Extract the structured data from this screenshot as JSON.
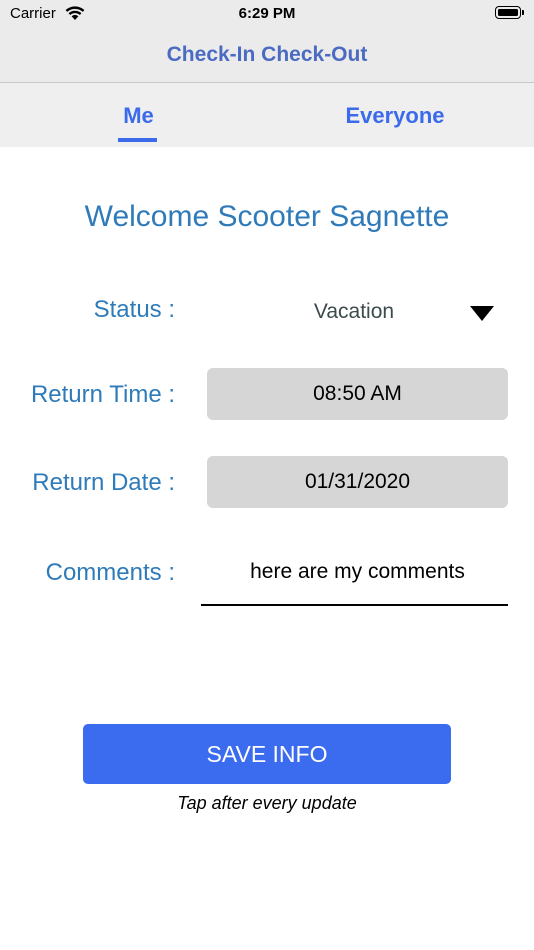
{
  "status_bar": {
    "carrier": "Carrier",
    "time": "6:29 PM"
  },
  "nav": {
    "title": "Check-In Check-Out"
  },
  "tabs": [
    {
      "label": "Me",
      "selected": true
    },
    {
      "label": "Everyone",
      "selected": false
    }
  ],
  "welcome": "Welcome Scooter Sagnette",
  "form": {
    "status_label": "Status :",
    "status_value": "Vacation",
    "return_time_label": "Return Time :",
    "return_time_value": "08:50 AM",
    "return_date_label": "Return Date :",
    "return_date_value": "01/31/2020",
    "comments_label": "Comments :",
    "comments_value": "here are my comments"
  },
  "save": {
    "label": "SAVE INFO",
    "hint": "Tap after every update"
  },
  "colors": {
    "accent": "#3b6bef",
    "label": "#2f7bb9",
    "nav_title": "#4a6bc1"
  }
}
